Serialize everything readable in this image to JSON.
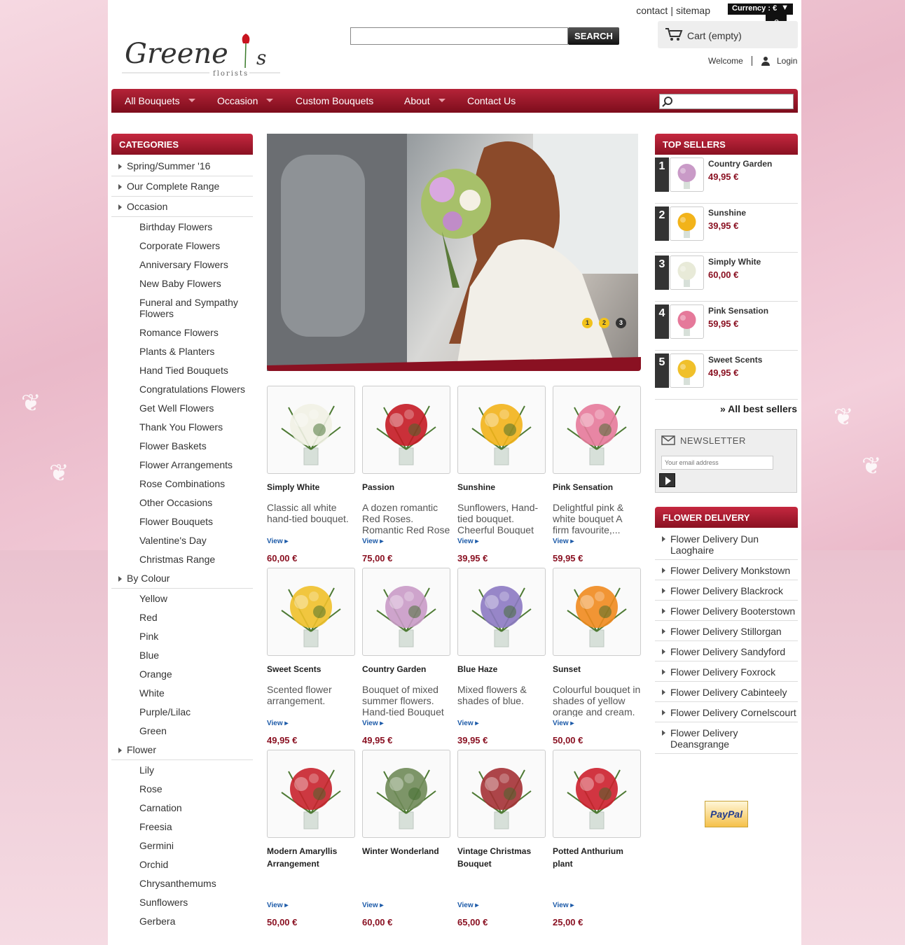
{
  "header": {
    "contact": "contact",
    "separator": "|",
    "sitemap": "sitemap",
    "currency_label": "Currency : €",
    "currency_value": "€",
    "search_button": "SEARCH",
    "cart": "Cart (empty)",
    "welcome": "Welcome",
    "login": "Login",
    "logo_text": "Greene",
    "logo_suffix": "s",
    "logo_sub": "florists"
  },
  "nav": {
    "items": [
      "All Bouquets",
      "Occasion",
      "Custom Bouquets",
      "About",
      "Contact Us"
    ]
  },
  "categories": {
    "title": "CATEGORIES",
    "groups": [
      {
        "label": "Spring/Summer '16",
        "children": []
      },
      {
        "label": "Our Complete Range",
        "children": []
      },
      {
        "label": "Occasion",
        "children": [
          "Birthday Flowers",
          "Corporate Flowers",
          "Anniversary Flowers",
          "New Baby Flowers",
          "Funeral and Sympathy Flowers",
          "Romance Flowers",
          "Plants & Planters",
          "Hand Tied Bouquets",
          "Congratulations Flowers",
          "Get Well Flowers",
          "Thank You Flowers",
          "Flower Baskets",
          "Flower Arrangements",
          "Rose Combinations",
          "Other Occasions",
          "Flower Bouquets",
          "Valentine's Day",
          "Christmas Range"
        ]
      },
      {
        "label": "By Colour",
        "children": [
          "Yellow",
          "Red",
          "Pink",
          "Blue",
          "Orange",
          "White",
          "Purple/Lilac",
          "Green"
        ]
      },
      {
        "label": "Flower",
        "children": [
          "Lily",
          "Rose",
          "Carnation",
          "Freesia",
          "Germini",
          "Orchid",
          "Chrysanthemums",
          "Sunflowers",
          "Gerbera"
        ]
      }
    ]
  },
  "slider": {
    "dots": [
      "1",
      "2",
      "3"
    ]
  },
  "products": [
    {
      "name": "Simply White",
      "desc": "Classic all white hand-tied bouquet.",
      "view": "View",
      "price": "60,00 €",
      "color": "#f1f1e4"
    },
    {
      "name": "Passion",
      "desc": " A dozen romantic Red Roses. Romantic Red Rose Bouquet...",
      "view": "View",
      "price": "75,00 €",
      "color": "#c41a24"
    },
    {
      "name": "Sunshine",
      "desc": "Sunflowers, Hand-tied bouquet. Cheerful Bouquet of...",
      "view": "View",
      "price": "39,95 €",
      "color": "#f2b31a"
    },
    {
      "name": "Pink Sensation",
      "desc": "Delightful pink & white bouquet A firm favourite,...",
      "view": "View",
      "price": "59,95 €",
      "color": "#e5799a"
    },
    {
      "name": "Sweet Scents",
      "desc": "Scented flower arrangement.",
      "view": "View",
      "price": "49,95 €",
      "color": "#f0c02a"
    },
    {
      "name": "Country Garden",
      "desc": "Bouquet of mixed summer flowers. Hand-tied Bouquet of...",
      "view": "View",
      "price": "49,95 €",
      "color": "#c99ac7"
    },
    {
      "name": "Blue Haze",
      "desc": "Mixed flowers & shades of blue.",
      "view": "View",
      "price": "39,95 €",
      "color": "#8c79c2"
    },
    {
      "name": "Sunset",
      "desc": "Colourful bouquet in shades of yellow orange and cream. A...",
      "view": "View",
      "price": "50,00 €",
      "color": "#f08a1e"
    },
    {
      "name": "Modern Amaryllis Arrangement",
      "desc": "",
      "view": "View",
      "price": "50,00 €",
      "color": "#c8222c"
    },
    {
      "name": "Winter Wonderland",
      "desc": "",
      "view": "View",
      "price": "60,00 €",
      "color": "#6f8a58"
    },
    {
      "name": "Vintage Christmas Bouquet",
      "desc": "",
      "view": "View",
      "price": "65,00 €",
      "color": "#a43135"
    },
    {
      "name": "Potted Anthurium plant",
      "desc": "",
      "view": "View",
      "price": "25,00 €",
      "color": "#cc1f2c"
    }
  ],
  "top_sellers": {
    "title": "TOP SELLERS",
    "items": [
      {
        "rank": "1",
        "name": "Country Garden",
        "price": "49,95 €",
        "color": "#c99ac7"
      },
      {
        "rank": "2",
        "name": "Sunshine",
        "price": "39,95 €",
        "color": "#f2b31a"
      },
      {
        "rank": "3",
        "name": "Simply White",
        "price": "60,00 €",
        "color": "#e8ead8"
      },
      {
        "rank": "4",
        "name": "Pink Sensation",
        "price": "59,95 €",
        "color": "#e5799a"
      },
      {
        "rank": "5",
        "name": "Sweet Scents",
        "price": "49,95 €",
        "color": "#f0c02a"
      }
    ],
    "all": "» All best sellers"
  },
  "newsletter": {
    "title": "NEWSLETTER",
    "placeholder": "Your email address"
  },
  "delivery": {
    "title": "FLOWER DELIVERY",
    "items": [
      "Flower Delivery Dun Laoghaire",
      "Flower Delivery Monkstown",
      "Flower Delivery Blackrock",
      "Flower Delivery Booterstown",
      "Flower Delivery Stillorgan",
      "Flower Delivery Sandyford",
      "Flower Delivery Foxrock",
      "Flower Delivery Cabinteely",
      "Flower Delivery Cornelscourt",
      "Flower Delivery Deansgrange"
    ]
  },
  "paypal": "PayPal",
  "colors": {
    "brand": "#8a1122",
    "link": "#1c5aa8"
  }
}
